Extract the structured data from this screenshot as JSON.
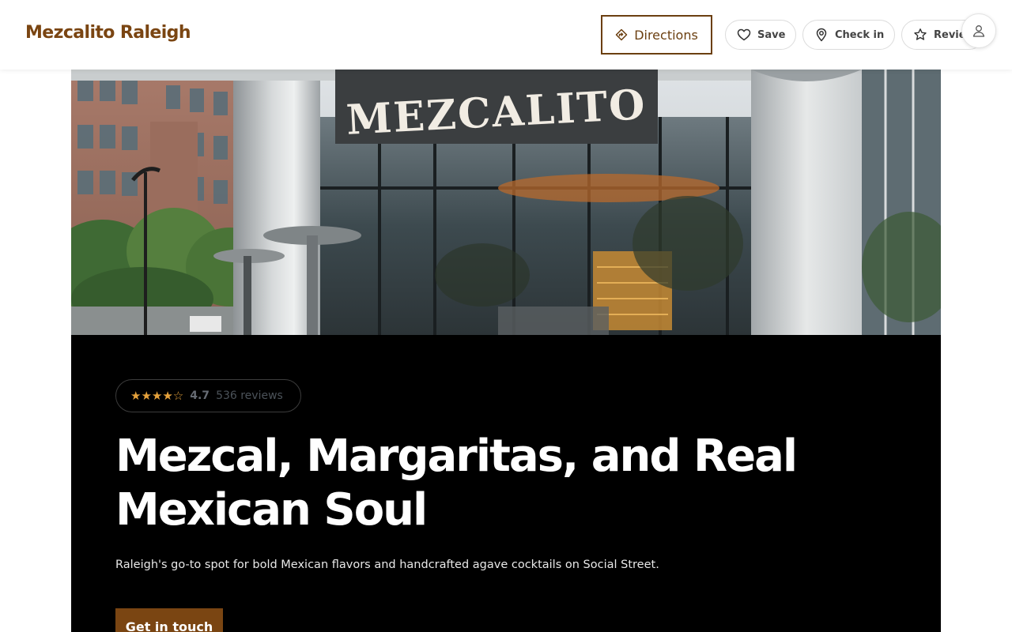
{
  "header": {
    "brand": "Mezcalito Raleigh",
    "directions_label": "Directions",
    "actions": [
      {
        "label": "Save",
        "icon": "heart-icon"
      },
      {
        "label": "Check in",
        "icon": "map-pin-icon"
      },
      {
        "label": "Review",
        "icon": "star-icon"
      }
    ],
    "account_icon": "user-icon"
  },
  "hero": {
    "sign_text": "MEZCALITO",
    "rating_stars": "★★★★☆",
    "rating_value": "4.7",
    "review_count": "536 reviews",
    "headline": "Mezcal, Margaritas, and Real Mexican Soul",
    "tagline": "Raleigh's go-to spot for bold Mexican flavors and handcrafted agave cocktails on Social Street.",
    "cta_label": "Get in touch"
  },
  "colors": {
    "brand": "#7a4512",
    "panel_bg": "#000000",
    "star": "#e6a23c"
  }
}
